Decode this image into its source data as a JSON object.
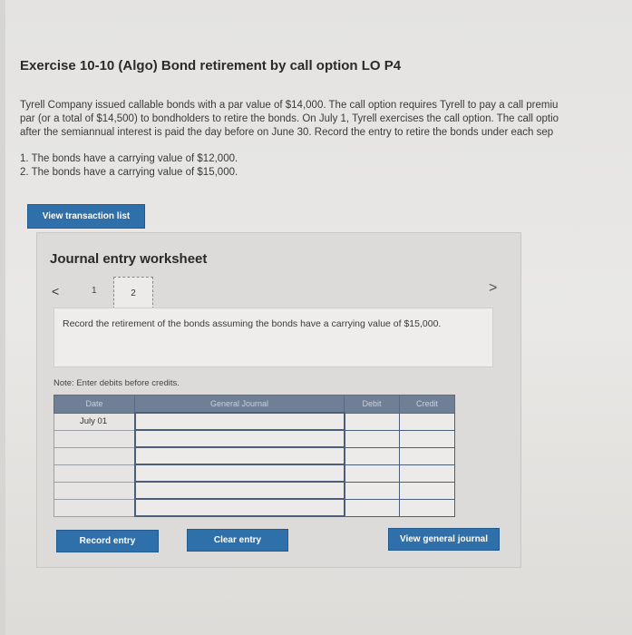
{
  "exercise": {
    "title": "Exercise 10-10 (Algo) Bond retirement by call option LO P4",
    "paragraph_lines": [
      "Tyrell Company issued callable bonds with a par value of $14,000. The call option requires Tyrell to pay a call premiu",
      "par (or a total of $14,500) to bondholders to retire the bonds. On July 1, Tyrell exercises the call option. The call optio",
      "after the semiannual interest is paid the day before on June 30. Record the entry to retire the bonds under each sep"
    ],
    "requirements": [
      "1. The bonds have a carrying value of $12,000.",
      "2. The bonds have a carrying value of $15,000."
    ]
  },
  "buttons": {
    "view_transaction_list": "View transaction list",
    "record_entry": "Record entry",
    "clear_entry": "Clear entry",
    "view_general_journal": "View general journal"
  },
  "worksheet": {
    "title": "Journal entry worksheet",
    "nav_prev": "<",
    "nav_next": ">",
    "pages": [
      "1",
      "2"
    ],
    "prompt": "Record the retirement of the bonds assuming the bonds have a carrying value of $15,000.",
    "note": "Note: Enter debits before credits."
  },
  "journal_table": {
    "headers": [
      "Date",
      "General Journal",
      "Debit",
      "Credit"
    ],
    "rows": [
      {
        "date": "July 01",
        "account": "",
        "debit": "",
        "credit": ""
      },
      {
        "date": "",
        "account": "",
        "debit": "",
        "credit": ""
      },
      {
        "date": "",
        "account": "",
        "debit": "",
        "credit": ""
      },
      {
        "date": "",
        "account": "",
        "debit": "",
        "credit": ""
      },
      {
        "date": "",
        "account": "",
        "debit": "",
        "credit": ""
      },
      {
        "date": "",
        "account": "",
        "debit": "",
        "credit": ""
      }
    ]
  },
  "colors": {
    "button_blue": "#2f6faa",
    "table_header": "#6f7f95",
    "page_background": "#e6e5e3"
  }
}
